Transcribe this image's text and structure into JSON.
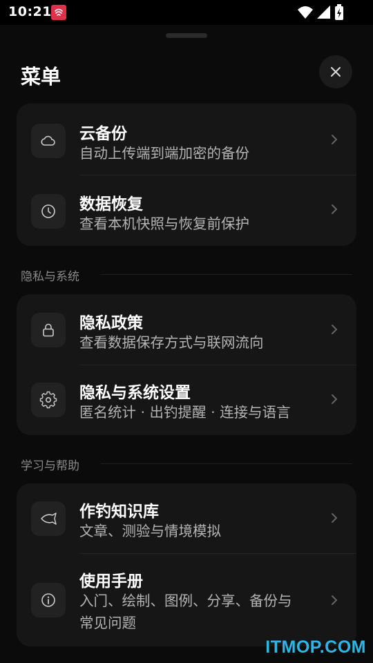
{
  "status_bar": {
    "time": "10:21"
  },
  "sheet": {
    "title": "菜单"
  },
  "top_card": {
    "items": [
      {
        "icon": "cloud-icon",
        "title": "云备份",
        "subtitle": "自动上传端到端加密的备份"
      },
      {
        "icon": "clock-icon",
        "title": "数据恢复",
        "subtitle": "查看本机快照与恢复前保护"
      }
    ]
  },
  "sections": [
    {
      "label": "隐私与系统",
      "items": [
        {
          "icon": "lock-icon",
          "title": "隐私政策",
          "subtitle": "查看数据保存方式与联网流向"
        },
        {
          "icon": "gear-icon",
          "title": "隐私与系统设置",
          "subtitle": "匿名统计 · 出钓提醒 · 连接与语言"
        }
      ]
    },
    {
      "label": "学习与帮助",
      "items": [
        {
          "icon": "fish-icon",
          "title": "作钓知识库",
          "subtitle": "文章、测验与情境模拟"
        },
        {
          "icon": "info-icon",
          "title": "使用手册",
          "subtitle": "入门、绘制、图例、分享、备份与",
          "subtitle2": "常见问题"
        }
      ]
    }
  ],
  "watermark": "ITMOP.COM"
}
